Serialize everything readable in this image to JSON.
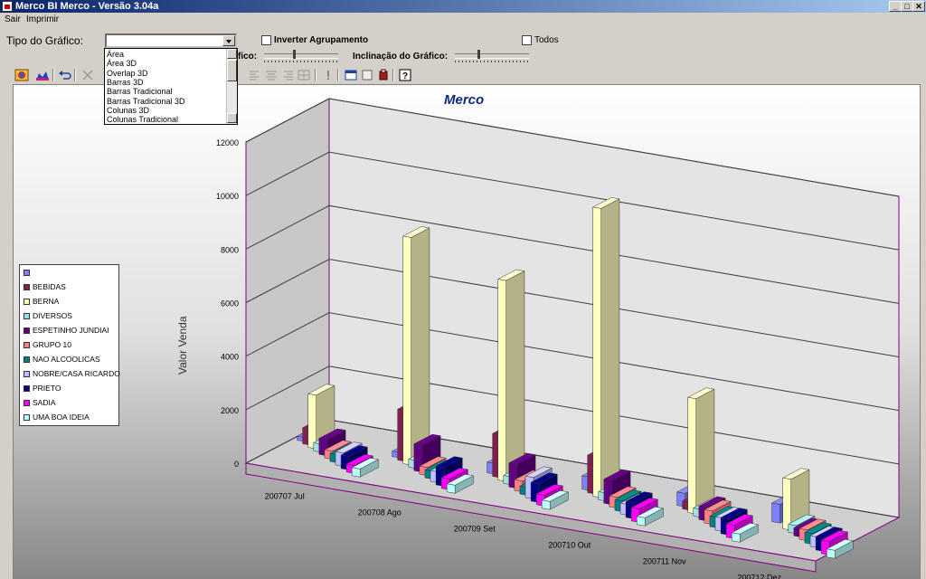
{
  "window": {
    "title": "Merco BI Merco - Versão 3.04a",
    "buttons": {
      "minimize": "_",
      "maximize": "□",
      "close": "✕"
    }
  },
  "menu": [
    "Sair",
    "Imprimir"
  ],
  "controls": {
    "chart_type_label": "Tipo do Gráfico:",
    "chart_type_value": "",
    "invert_grouping_label": "Inverter Agrupamento",
    "all_label": "Todos",
    "rotation_label_partial": "fico:",
    "tilt_label": "Inclinação do Gráfico:"
  },
  "dropdown": {
    "options": [
      "Área",
      "Área 3D",
      "Overlap 3D",
      "Barras 3D",
      "Barras Tradicional",
      "Barras Tradicional 3D",
      "Colunas 3D",
      "Colunas Tradicional"
    ]
  },
  "colors": {
    "titlebar": "#0a246a",
    "chart_title": "#0a2a7a"
  },
  "chart_data": {
    "type": "bar",
    "title": "Merco",
    "ylabel": "Valor Venda",
    "xlabel": "",
    "ylim": [
      0,
      12000
    ],
    "yticks": [
      0,
      2000,
      4000,
      6000,
      8000,
      10000,
      12000
    ],
    "categories": [
      "200707 Jul",
      "200708 Ago",
      "200709 Set",
      "200710 Out",
      "200711 Nov",
      "200712 Dez"
    ],
    "legend_position": "left",
    "series": [
      {
        "name": "",
        "color": "#8080ff",
        "values": [
          150,
          200,
          400,
          500,
          500,
          700
        ]
      },
      {
        "name": "BEBIDAS",
        "color": "#802050",
        "values": [
          600,
          1900,
          1600,
          1400,
          300,
          0
        ]
      },
      {
        "name": "BERNA",
        "color": "#ffffc0",
        "values": [
          2000,
          8500,
          7500,
          10800,
          4300,
          1900
        ]
      },
      {
        "name": "DIVERSOS",
        "color": "#a0e0e0",
        "values": [
          300,
          300,
          300,
          300,
          300,
          300
        ]
      },
      {
        "name": "ESPETINHO JUNDIAI",
        "color": "#600080",
        "values": [
          600,
          1000,
          900,
          900,
          500,
          300
        ]
      },
      {
        "name": "GRUPO 10",
        "color": "#ff8080",
        "values": [
          300,
          300,
          400,
          400,
          500,
          400
        ]
      },
      {
        "name": "NAO ALCOOLICAS",
        "color": "#008080",
        "values": [
          300,
          300,
          300,
          400,
          400,
          400
        ]
      },
      {
        "name": "NOBRE/CASA RICARDO",
        "color": "#c0c0ff",
        "values": [
          500,
          400,
          800,
          400,
          500,
          400
        ]
      },
      {
        "name": "PRIETO",
        "color": "#000080",
        "values": [
          500,
          700,
          700,
          600,
          600,
          500
        ]
      },
      {
        "name": "SADIA",
        "color": "#ff00ff",
        "values": [
          300,
          400,
          400,
          500,
          500,
          500
        ]
      },
      {
        "name": "UMA BOA IDEIA",
        "color": "#c0ffff",
        "values": [
          300,
          300,
          300,
          300,
          300,
          300
        ]
      }
    ]
  }
}
